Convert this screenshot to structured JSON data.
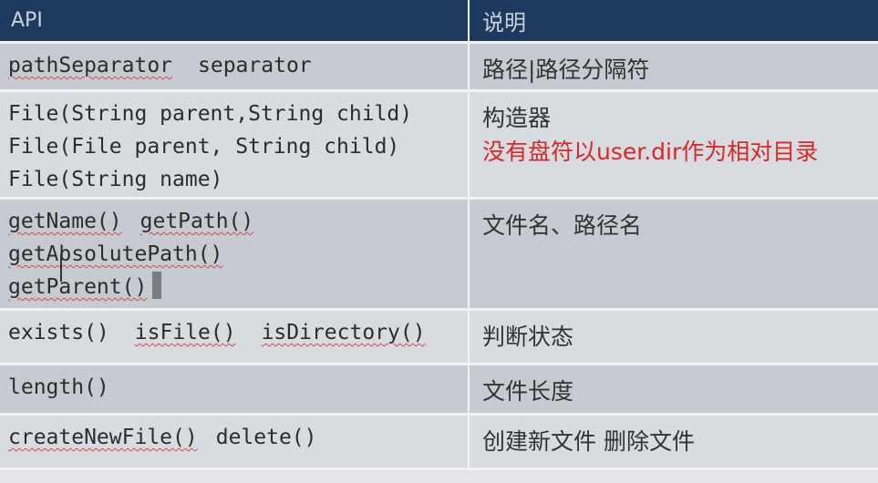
{
  "header": {
    "api": "API",
    "desc": "说明"
  },
  "rows": [
    {
      "code": [
        [
          "pathSeparator",
          "separator"
        ]
      ],
      "desc": "路径|路径分隔符"
    },
    {
      "code": [
        [
          "File(String parent,String child)"
        ],
        [
          "File(File parent, String child)"
        ],
        [
          "File(String name)"
        ]
      ],
      "desc": "构造器",
      "desc_red": "没有盘符以user.dir作为相对目录"
    },
    {
      "code": [
        [
          "getName()",
          "getPath()"
        ],
        [
          "getAbsolutePath()"
        ],
        [
          "getParent()"
        ]
      ],
      "desc": "文件名、路径名"
    },
    {
      "code": [
        [
          "exists()",
          "isFile()",
          "isDirectory()"
        ]
      ],
      "desc": "判断状态"
    },
    {
      "code": [
        [
          "length()"
        ]
      ],
      "desc": "文件长度"
    },
    {
      "code": [
        [
          "createNewFile()",
          "delete()"
        ]
      ],
      "desc": "创建新文件 删除文件"
    }
  ]
}
